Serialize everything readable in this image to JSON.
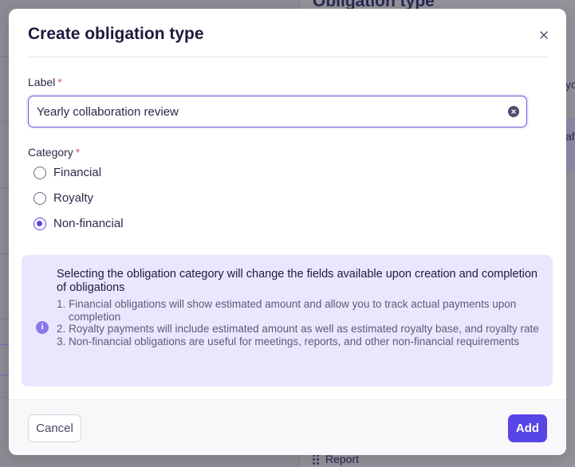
{
  "background": {
    "panel_title": "Obligation type",
    "fragment_1": "yo",
    "fragment_2": "af",
    "report_label": "Report"
  },
  "modal": {
    "title": "Create obligation type",
    "close_icon": "close-icon",
    "label_field": {
      "label": "Label",
      "required_mark": "*",
      "value": "Yearly collaboration review",
      "clear_icon": "clear-icon"
    },
    "category": {
      "label": "Category",
      "required_mark": "*",
      "options": [
        {
          "label": "Financial",
          "checked": false
        },
        {
          "label": "Royalty",
          "checked": false
        },
        {
          "label": "Non-financial",
          "checked": true
        }
      ]
    },
    "info": {
      "icon": "info-icon",
      "heading": "Selecting the obligation category will change the fields available upon creation and completion of obligations",
      "items": [
        {
          "num": "1.",
          "text": "Financial obligations will show estimated amount and allow you to track actual payments upon completion"
        },
        {
          "num": "2.",
          "text": "Royalty payments will include estimated amount as well as estimated royalty base, and royalty rate"
        },
        {
          "num": "3.",
          "text": "Non-financial obligations are useful for meetings, reports, and other non-financial requirements"
        }
      ]
    },
    "footer": {
      "cancel_label": "Cancel",
      "add_label": "Add"
    }
  },
  "colors": {
    "accent": "#5845e6",
    "info_bg": "#e9e7fd",
    "required": "#e0527a"
  }
}
